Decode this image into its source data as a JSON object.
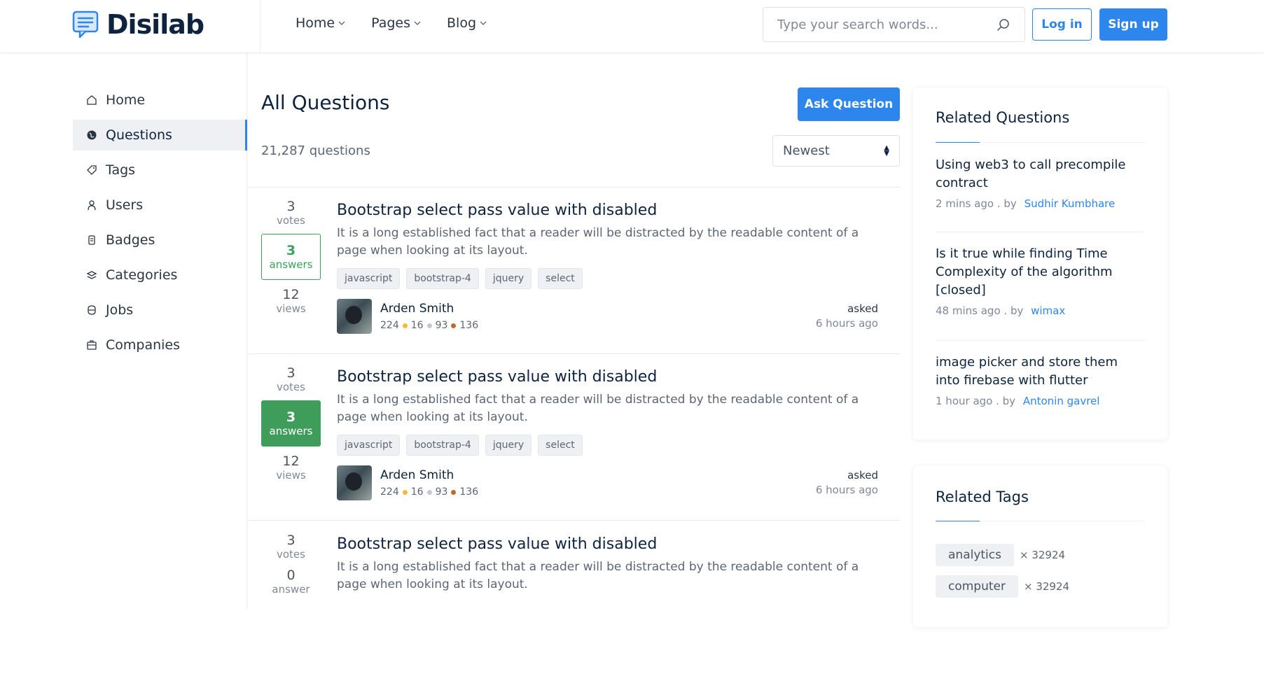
{
  "brand": {
    "name": "Disilab"
  },
  "nav": [
    {
      "label": "Home"
    },
    {
      "label": "Pages"
    },
    {
      "label": "Blog"
    }
  ],
  "search": {
    "placeholder": "Type your search words..."
  },
  "auth": {
    "login": "Log in",
    "signup": "Sign up"
  },
  "sidebar": {
    "items": [
      {
        "label": "Home",
        "icon": "home-icon"
      },
      {
        "label": "Questions",
        "icon": "globe-icon",
        "active": true
      },
      {
        "label": "Tags",
        "icon": "tag-icon"
      },
      {
        "label": "Users",
        "icon": "user-icon"
      },
      {
        "label": "Badges",
        "icon": "badge-icon"
      },
      {
        "label": "Categories",
        "icon": "layers-icon"
      },
      {
        "label": "Jobs",
        "icon": "briefcase-icon"
      },
      {
        "label": "Companies",
        "icon": "building-icon"
      }
    ]
  },
  "main": {
    "title": "All Questions",
    "ask_button": "Ask Question",
    "count": "21,287 questions",
    "sort": "Newest",
    "questions": [
      {
        "votes": "3",
        "votes_label": "votes",
        "answers": "3",
        "answers_label": "answers",
        "views": "12",
        "views_label": "views",
        "title": "Bootstrap select pass value with disabled",
        "excerpt": "It is a long established fact that a reader will be distracted by the readable content of a page when looking at its layout.",
        "tags": [
          "javascript",
          "bootstrap-4",
          "jquery",
          "select"
        ],
        "author": "Arden Smith",
        "rep": "224",
        "gold": "16",
        "silver": "93",
        "bronze": "136",
        "asked_label": "asked",
        "asked_time": "6 hours ago"
      },
      {
        "votes": "3",
        "votes_label": "votes",
        "answers": "3",
        "answers_label": "answers",
        "views": "12",
        "views_label": "views",
        "title": "Bootstrap select pass value with disabled",
        "excerpt": "It is a long established fact that a reader will be distracted by the readable content of a page when looking at its layout.",
        "tags": [
          "javascript",
          "bootstrap-4",
          "jquery",
          "select"
        ],
        "author": "Arden Smith",
        "rep": "224",
        "gold": "16",
        "silver": "93",
        "bronze": "136",
        "asked_label": "asked",
        "asked_time": "6 hours ago"
      },
      {
        "votes": "3",
        "votes_label": "votes",
        "answers": "0",
        "answers_label": "answer",
        "title": "Bootstrap select pass value with disabled",
        "excerpt": "It is a long established fact that a reader will be distracted by the readable content of a page when looking at its layout."
      }
    ]
  },
  "related_questions": {
    "title": "Related Questions",
    "items": [
      {
        "title": "Using web3 to call precompile contract",
        "time": "2 mins ago",
        "by": ". by",
        "user": "Sudhir Kumbhare"
      },
      {
        "title": "Is it true while finding Time Complexity of the algorithm [closed]",
        "time": "48 mins ago",
        "by": ". by",
        "user": "wimax"
      },
      {
        "title": "image picker and store them into firebase with flutter",
        "time": "1 hour ago",
        "by": ". by",
        "user": "Antonin gavrel"
      }
    ]
  },
  "related_tags": {
    "title": "Related Tags",
    "items": [
      {
        "name": "analytics",
        "count": "× 32924"
      },
      {
        "name": "computer",
        "count": "× 32924"
      }
    ]
  },
  "colors": {
    "accent": "#2d86eb",
    "success": "#3f9d5c",
    "gold": "#f3b93a",
    "silver": "#c7c9cc",
    "bronze": "#c0682a"
  }
}
